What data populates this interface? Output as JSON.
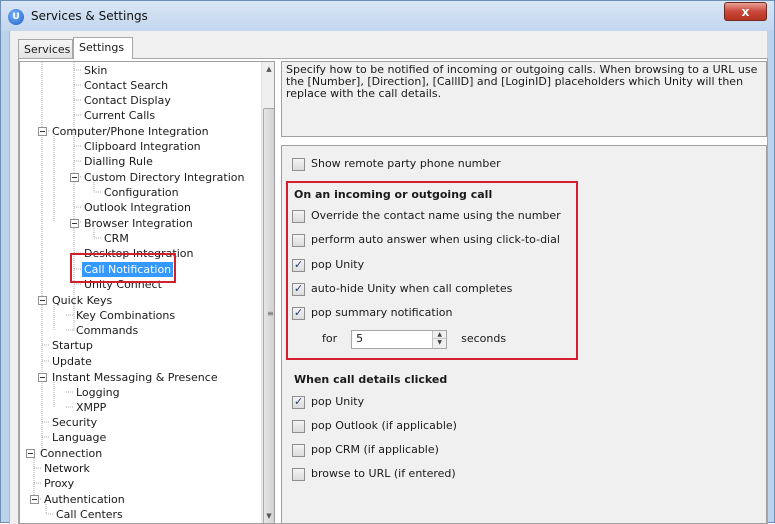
{
  "window": {
    "title": "Services & Settings",
    "app_icon_letter": "U",
    "close_label": "x"
  },
  "tabs": [
    {
      "label": "Services",
      "active": false
    },
    {
      "label": "Settings",
      "active": true
    }
  ],
  "tree": {
    "items": [
      {
        "label": "Skin",
        "level": 2
      },
      {
        "label": "Contact Search",
        "level": 2
      },
      {
        "label": "Contact Display",
        "level": 2
      },
      {
        "label": "Current Calls",
        "level": 2
      },
      {
        "label": "Computer/Phone Integration",
        "level": 1,
        "expander": true
      },
      {
        "label": "Clipboard Integration",
        "level": 2
      },
      {
        "label": "Dialling Rule",
        "level": 2
      },
      {
        "label": "Custom Directory Integration",
        "level": 2,
        "expander": true
      },
      {
        "label": "Configuration",
        "level": 3
      },
      {
        "label": "Outlook Integration",
        "level": 2
      },
      {
        "label": "Browser Integration",
        "level": 2,
        "expander": true
      },
      {
        "label": "CRM",
        "level": 3
      },
      {
        "label": "Desktop Integration",
        "level": 2
      },
      {
        "label": "Call Notification",
        "level": 2,
        "selected": true
      },
      {
        "label": "Unity Connect",
        "level": 2
      },
      {
        "label": "Quick Keys",
        "level": 1,
        "expander": true
      },
      {
        "label": "Key Combinations",
        "level": 2
      },
      {
        "label": "Commands",
        "level": 2
      },
      {
        "label": "Startup",
        "level": 1
      },
      {
        "label": "Update",
        "level": 1
      },
      {
        "label": "Instant Messaging & Presence",
        "level": 1,
        "expander": true
      },
      {
        "label": "Logging",
        "level": 2
      },
      {
        "label": "XMPP",
        "level": 2
      },
      {
        "label": "Security",
        "level": 1
      },
      {
        "label": "Language",
        "level": 1
      },
      {
        "label": "Connection",
        "level": 0,
        "expander": true
      },
      {
        "label": "Network",
        "level": 1
      },
      {
        "label": "Proxy",
        "level": 1
      },
      {
        "label": "Authentication",
        "level": 1,
        "expander": true
      },
      {
        "label": "Call Centers",
        "level": 2
      }
    ]
  },
  "description": "Specify how to be notified of incoming or outgoing calls.  When browsing to a URL use the [Number], [Direction], [CallID] and [LoginID] placeholders which Unity will then replace with the call details.",
  "options": {
    "show_remote_party": {
      "label": "Show remote party phone number",
      "checked": false
    },
    "call_section_heading": "On an incoming or outgoing call",
    "call_options": [
      {
        "label": "Override the contact name using the number",
        "checked": false
      },
      {
        "label": "perform auto answer when using click-to-dial",
        "checked": false
      },
      {
        "label": "pop Unity",
        "checked": true
      },
      {
        "label": "auto-hide Unity when call completes",
        "checked": true
      },
      {
        "label": "pop summary notification",
        "checked": true
      }
    ],
    "for_label": "for",
    "seconds_value": "5",
    "seconds_label": "seconds",
    "details_section_heading": "When call details clicked",
    "details_options": [
      {
        "label": "pop Unity",
        "checked": true
      },
      {
        "label": "pop Outlook (if applicable)",
        "checked": false
      },
      {
        "label": "pop CRM (if applicable)",
        "checked": false
      },
      {
        "label": "browse to URL (if entered)",
        "checked": false
      }
    ]
  },
  "colors": {
    "highlight_red": "#d4202e",
    "selection_blue": "#3399ff"
  }
}
